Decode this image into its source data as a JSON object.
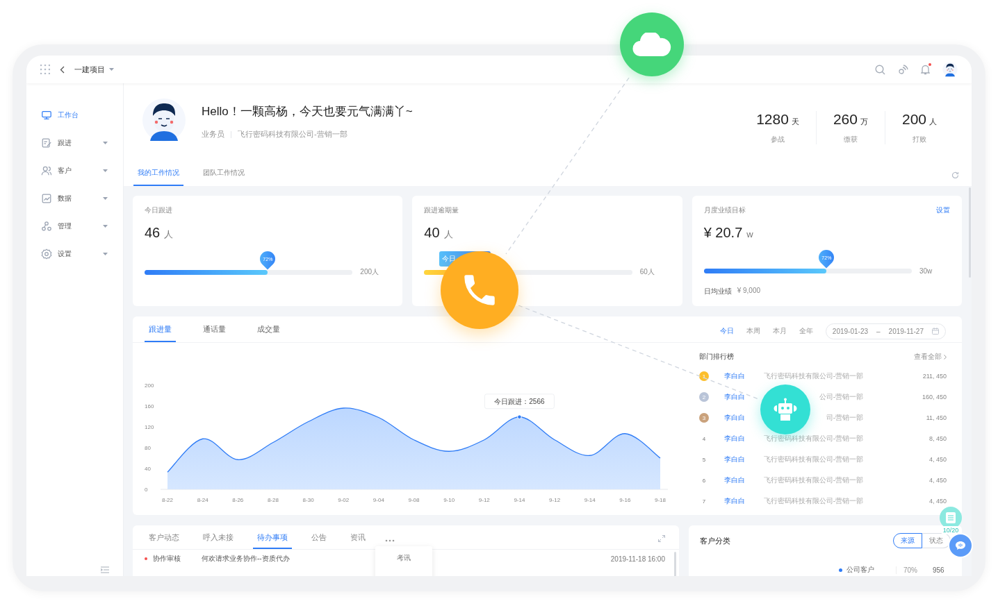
{
  "topbar": {
    "project": "一建项目"
  },
  "sidebar": {
    "items": [
      {
        "label": "工作台",
        "selected": true,
        "expandable": false
      },
      {
        "label": "跟进",
        "selected": false,
        "expandable": true
      },
      {
        "label": "客户",
        "selected": false,
        "expandable": true
      },
      {
        "label": "数据",
        "selected": false,
        "expandable": true
      },
      {
        "label": "管理",
        "selected": false,
        "expandable": true
      },
      {
        "label": "设置",
        "selected": false,
        "expandable": true
      }
    ]
  },
  "profile": {
    "greeting": "Hello！一颗高杨，今天也要元气满满丫~",
    "role": "业务员",
    "company": "飞行密码科技有限公司-营销一部"
  },
  "stats": [
    {
      "value": "1280",
      "unit": "天",
      "label": "参战"
    },
    {
      "value": "260",
      "unit": "万",
      "label": "缴获"
    },
    {
      "value": "200",
      "unit": "人",
      "label": "打败"
    }
  ],
  "view_tabs": [
    {
      "label": "我的工作情况",
      "selected": true
    },
    {
      "label": "团队工作情况",
      "selected": false
    }
  ],
  "cards": [
    {
      "kind": "pin",
      "title": "今日跟进",
      "value": "46",
      "unit": "人",
      "level": 0.59,
      "bubble": "72%",
      "max": "200人"
    },
    {
      "kind": "banner",
      "title": "跟进逾期量",
      "value": "40",
      "unit": "人",
      "level": 0.2,
      "bubble": "今日",
      "max": "60人"
    },
    {
      "kind": "pin",
      "title": "月度业绩目标",
      "link": "设置",
      "value": "¥ 20.7",
      "unit": "w",
      "level": 0.59,
      "bubble": "72%",
      "max": "30w",
      "footer_label": "日均业绩",
      "footer_value": "¥ 9,000"
    }
  ],
  "trend": {
    "tabs": [
      {
        "label": "跟进量",
        "selected": true
      },
      {
        "label": "通话量",
        "selected": false
      },
      {
        "label": "成交量",
        "selected": false
      }
    ],
    "ranges": [
      {
        "label": "今日",
        "selected": true
      },
      {
        "label": "本周",
        "selected": false
      },
      {
        "label": "本月",
        "selected": false
      },
      {
        "label": "全年",
        "selected": false
      }
    ],
    "date_from": "2019-01-23",
    "date_sep": "–",
    "date_to": "2019-11-27",
    "chart_data": {
      "type": "area",
      "categories": [
        "8-22",
        "8-24",
        "8-26",
        "8-28",
        "8-30",
        "9-02",
        "9-04",
        "9-08",
        "9-10",
        "9-12",
        "9-14",
        "9-12",
        "9-14",
        "9-16",
        "9-18"
      ],
      "series": [
        {
          "color": "#2f7cf6",
          "values": [
            33,
            97,
            57,
            90,
            130,
            156,
            138,
            95,
            73,
            95,
            139,
            95,
            65,
            107,
            60
          ]
        }
      ],
      "ylim": [
        0,
        200
      ],
      "yticks": [
        {
          "value": 0,
          "label": "0"
        },
        {
          "value": 40,
          "label": "40"
        },
        {
          "value": 80,
          "label": "80"
        },
        {
          "value": 120,
          "label": "120"
        },
        {
          "value": 160,
          "label": "160"
        },
        {
          "value": 200,
          "label": "200"
        }
      ],
      "annotations": [
        {
          "x": "9-14",
          "y": 139,
          "text": "今日跟进：2566"
        }
      ]
    }
  },
  "ranking": {
    "title": "部门排行榜",
    "link": "查看全部",
    "rows": [
      {
        "kind": "medal",
        "rank": "1",
        "color": "#fcbf2c",
        "name": "李白白",
        "company": "飞行密码科技有限公司-营销一部",
        "value": "211, 450"
      },
      {
        "kind": "medal",
        "rank": "2",
        "color": "#b9c4d8",
        "name": "李白白",
        "company": "公司-营销一部",
        "value": "160, 450"
      },
      {
        "kind": "medal",
        "rank": "3",
        "color": "#caa27c",
        "name": "李白白",
        "company": "司-营销一部",
        "value": "11, 450"
      },
      {
        "kind": "plain",
        "rank": "4",
        "name": "李白白",
        "company": "飞行密码科技有限公司-营销一部",
        "value": "8, 450"
      },
      {
        "kind": "plain",
        "rank": "5",
        "name": "李白白",
        "company": "飞行密码科技有限公司-营销一部",
        "value": "4, 450"
      },
      {
        "kind": "plain",
        "rank": "6",
        "name": "李白白",
        "company": "飞行密码科技有限公司-营销一部",
        "value": "4, 450"
      },
      {
        "kind": "plain",
        "rank": "7",
        "name": "李白白",
        "company": "飞行密码科技有限公司-营销一部",
        "value": "4, 450"
      }
    ]
  },
  "feed": {
    "tabs": [
      {
        "label": "客户动态",
        "selected": false
      },
      {
        "label": "呼入未接",
        "selected": false
      },
      {
        "label": "待办事项",
        "selected": true
      },
      {
        "label": "公告",
        "selected": false
      },
      {
        "label": "资讯",
        "selected": false
      }
    ],
    "menu": [
      "考讯"
    ],
    "items": [
      {
        "type": "协作审核",
        "text": "何欢请求业务协作--资质代办",
        "time": "2019-11-18 16:00"
      }
    ]
  },
  "classify": {
    "title": "客户分类",
    "segments": [
      {
        "label": "来源",
        "selected": true
      },
      {
        "label": "状态",
        "selected": false
      }
    ],
    "legend": [
      {
        "label": "公司客户",
        "color": "#2f7cf6",
        "share": "70%",
        "count": "956"
      }
    ]
  },
  "float_tools": {
    "counter": "10/20"
  }
}
